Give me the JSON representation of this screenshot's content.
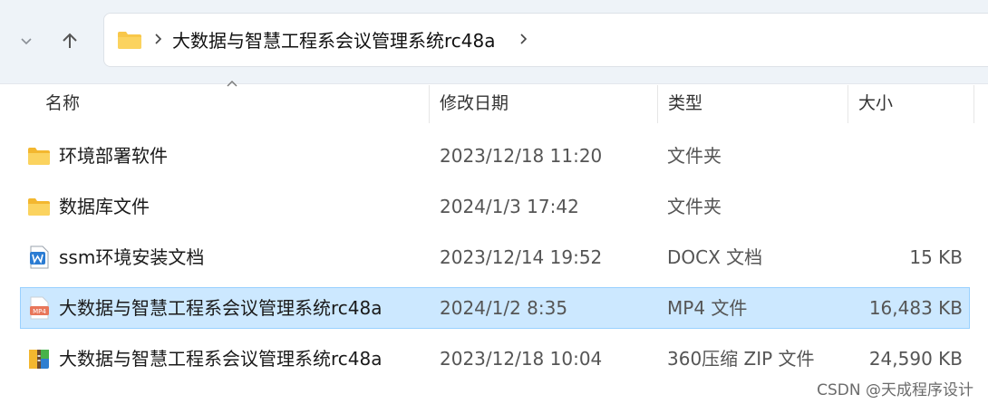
{
  "address": {
    "path": "大数据与智慧工程系会议管理系统rc48a",
    "separator": "›"
  },
  "columns": {
    "name": "名称",
    "modified": "修改日期",
    "type": "类型",
    "size": "大小"
  },
  "files": [
    {
      "name": "环境部署软件",
      "modified": "2023/12/18 11:20",
      "type": "文件夹",
      "size": "",
      "icon": "folder-icon"
    },
    {
      "name": "数据库文件",
      "modified": "2024/1/3 17:42",
      "type": "文件夹",
      "size": "",
      "icon": "folder-icon"
    },
    {
      "name": "ssm环境安装文档",
      "modified": "2023/12/14 19:52",
      "type": "DOCX 文档",
      "size": "15 KB",
      "icon": "word-doc-icon"
    },
    {
      "name": "大数据与智慧工程系会议管理系统rc48a",
      "modified": "2024/1/2 8:35",
      "type": "MP4 文件",
      "size": "16,483 KB",
      "icon": "mp4-file-icon",
      "selected": true
    },
    {
      "name": "大数据与智慧工程系会议管理系统rc48a",
      "modified": "2023/12/18 10:04",
      "type": "360压缩 ZIP 文件",
      "size": "24,590 KB",
      "icon": "zip-archive-icon"
    }
  ],
  "watermark": "CSDN @天成程序设计",
  "colors": {
    "selected_bg": "#cce8ff",
    "selected_border": "#99d1ff",
    "folder": "#f8c74a",
    "word": "#2b7cd3",
    "mp4": "#e8765a"
  }
}
